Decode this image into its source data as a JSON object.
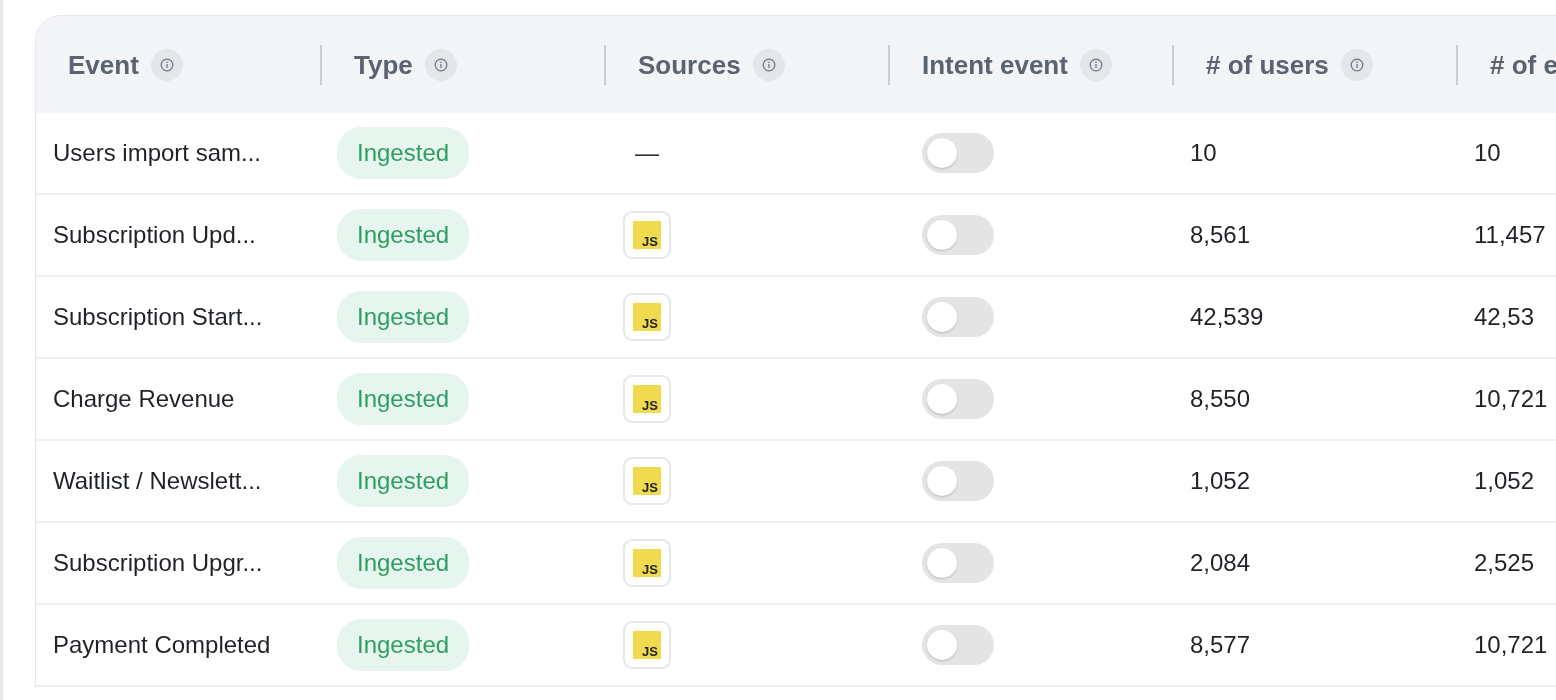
{
  "table": {
    "columns": [
      {
        "label": "Event",
        "info": true
      },
      {
        "label": "Type",
        "info": true
      },
      {
        "label": "Sources",
        "info": true
      },
      {
        "label": "Intent event",
        "info": true
      },
      {
        "label": "# of users",
        "info": true
      },
      {
        "label": "# of e",
        "info": false
      }
    ],
    "rows": [
      {
        "event": "Users import sam...",
        "type": "Ingested",
        "source": {
          "kind": "none",
          "label": "—"
        },
        "intent_event": {
          "on": false
        },
        "users": "10",
        "events": "10"
      },
      {
        "event": "Subscription Upd...",
        "type": "Ingested",
        "source": {
          "kind": "js",
          "label": "JS"
        },
        "intent_event": {
          "on": false
        },
        "users": "8,561",
        "events": "11,457"
      },
      {
        "event": "Subscription Start...",
        "type": "Ingested",
        "source": {
          "kind": "js",
          "label": "JS"
        },
        "intent_event": {
          "on": false
        },
        "users": "42,539",
        "events": "42,53"
      },
      {
        "event": "Charge Revenue",
        "type": "Ingested",
        "source": {
          "kind": "js",
          "label": "JS"
        },
        "intent_event": {
          "on": false
        },
        "users": "8,550",
        "events": "10,721"
      },
      {
        "event": "Waitlist / Newslett...",
        "type": "Ingested",
        "source": {
          "kind": "js",
          "label": "JS"
        },
        "intent_event": {
          "on": false
        },
        "users": "1,052",
        "events": "1,052"
      },
      {
        "event": "Subscription Upgr...",
        "type": "Ingested",
        "source": {
          "kind": "js",
          "label": "JS"
        },
        "intent_event": {
          "on": false
        },
        "users": "2,084",
        "events": "2,525"
      },
      {
        "event": "Payment Completed",
        "type": "Ingested",
        "source": {
          "kind": "js",
          "label": "JS"
        },
        "intent_event": {
          "on": false
        },
        "users": "8,577",
        "events": "10,721"
      }
    ]
  }
}
